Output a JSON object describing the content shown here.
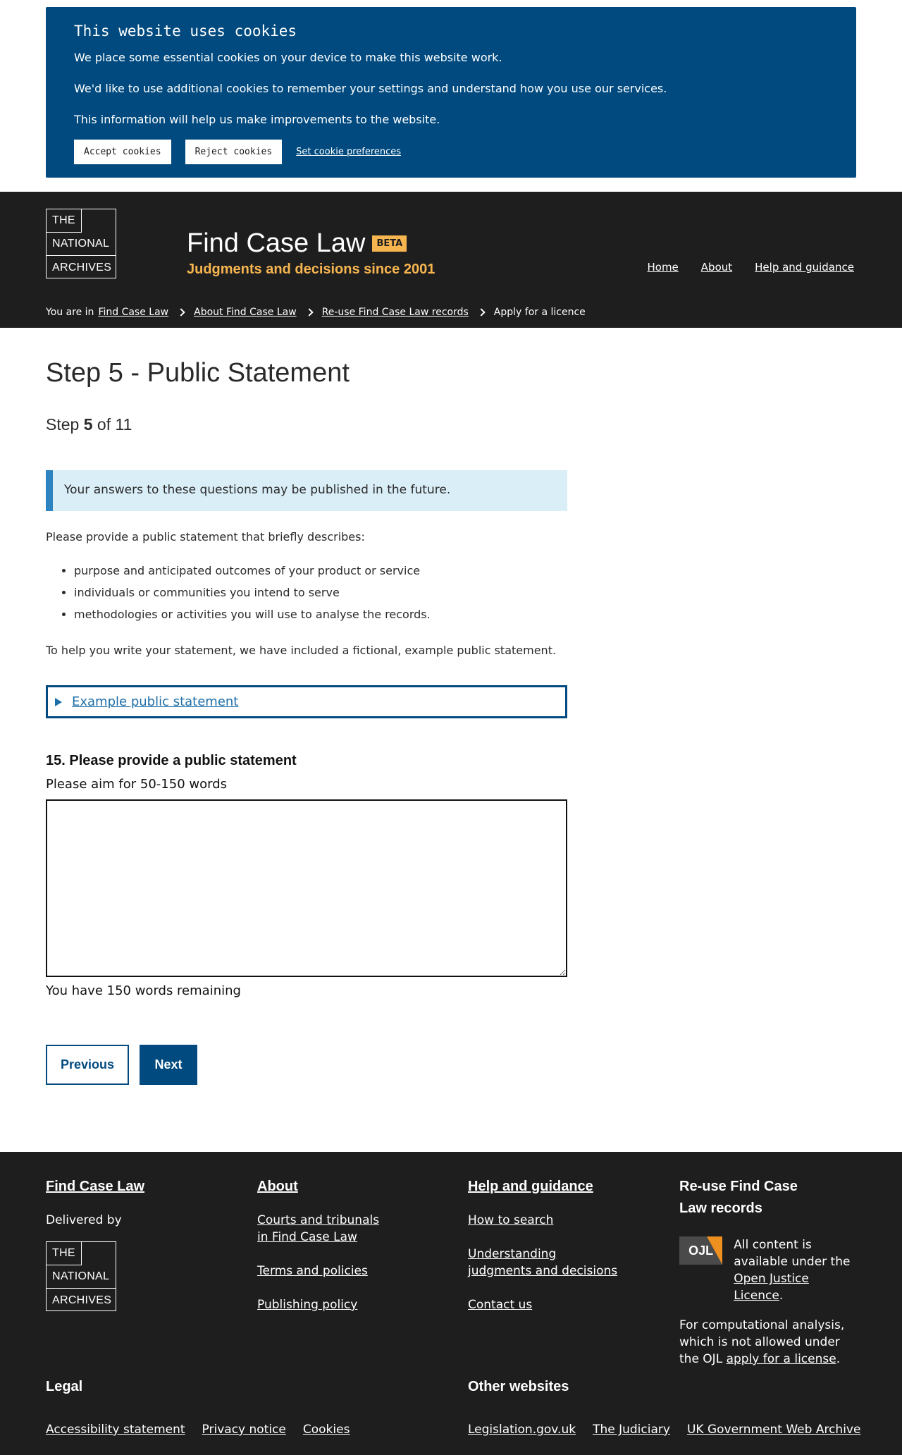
{
  "cookie_banner": {
    "title": "This website uses cookies",
    "p1": "We place some essential cookies on your device to make this website work.",
    "p2": "We'd like to use additional cookies to remember your settings and understand how you use our services.",
    "p3": "This information will help us make improvements to the website.",
    "accept": "Accept cookies",
    "reject": "Reject cookies",
    "preferences": "Set cookie preferences"
  },
  "logo": {
    "line1": "THE",
    "line2": "NATIONAL",
    "line3": "ARCHIVES"
  },
  "header": {
    "title": "Find Case Law",
    "badge": "BETA",
    "subtitle": "Judgments and decisions since 2001",
    "nav": [
      "Home",
      "About",
      "Help and guidance"
    ]
  },
  "breadcrumb": {
    "prefix": "You are in",
    "items": [
      "Find Case Law",
      "About Find Case Law",
      "Re-use Find Case Law records",
      "Apply for a licence"
    ]
  },
  "main": {
    "title": "Step 5 - Public Statement",
    "step_prefix": "Step",
    "step_current": "5",
    "step_suffix": "of 11",
    "notice": "Your answers to these questions may be published in the future.",
    "intro": "Please provide a public statement that briefly describes:",
    "bullets": [
      "purpose and anticipated outcomes of your product or service",
      "individuals or communities you intend to serve",
      "methodologies or activities you will use to analyse the records."
    ],
    "helper": "To help you write your statement, we have included a fictional, example public statement.",
    "details_summary": "Example public statement",
    "question_label": "15. Please provide a public statement",
    "question_hint": "Please aim for 50-150 words",
    "textarea_value": "",
    "remaining": "You have 150 words remaining",
    "previous": "Previous",
    "next": "Next"
  },
  "footer": {
    "col1": {
      "heading": "Find Case Law",
      "delivered_by": "Delivered by"
    },
    "col2": {
      "heading": "About",
      "links": [
        "Courts and tribunals in Find Case Law",
        "Terms and policies",
        "Publishing policy"
      ]
    },
    "col3": {
      "heading": "Help and guidance",
      "links": [
        "How to search",
        "Understanding judgments and decisions",
        "Contact us"
      ]
    },
    "col4": {
      "heading": "Re-use Find Case Law records",
      "ojl_badge": "OJL",
      "licence_text": "All content is available under the",
      "licence_link": "Open Justice Licence",
      "licence_end": ".",
      "computational_text": "For computational analysis, which is not allowed under the OJL",
      "computational_link": "apply for a license",
      "computational_end": "."
    },
    "legal": {
      "heading": "Legal",
      "links": [
        "Accessibility statement",
        "Privacy notice",
        "Cookies"
      ]
    },
    "other": {
      "heading": "Other websites",
      "links": [
        "Legislation.gov.uk",
        "The Judiciary",
        "UK Government Web Archive"
      ]
    }
  }
}
